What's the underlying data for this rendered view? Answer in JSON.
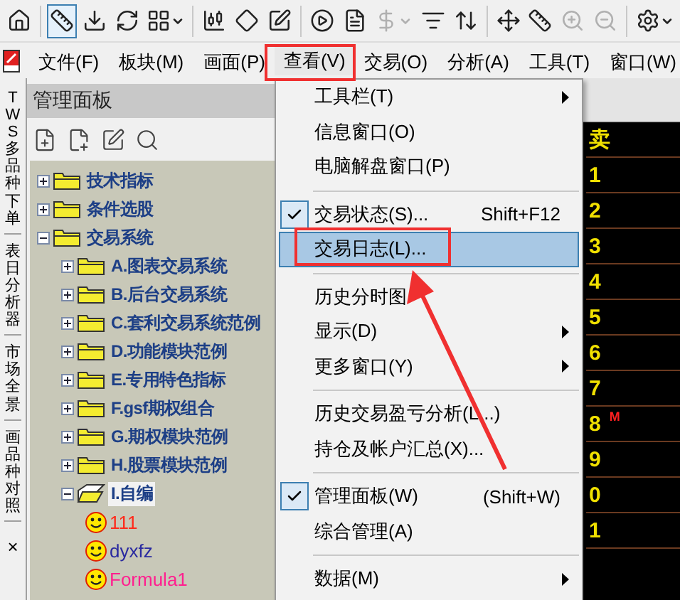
{
  "toolbar": [
    {
      "kind": "button",
      "selected": false,
      "disabled": false
    },
    {
      "kind": "separator"
    },
    {
      "kind": "button",
      "selected": true,
      "disabled": false
    },
    {
      "kind": "button",
      "selected": false,
      "disabled": false
    },
    {
      "kind": "button",
      "selected": false,
      "disabled": false
    },
    {
      "kind": "dropdown",
      "selected": false,
      "disabled": false
    },
    {
      "kind": "separator"
    },
    {
      "kind": "button",
      "selected": false,
      "disabled": false
    },
    {
      "kind": "button",
      "selected": false,
      "disabled": false
    },
    {
      "kind": "button",
      "selected": false,
      "disabled": false
    },
    {
      "kind": "separator"
    },
    {
      "kind": "button",
      "selected": false,
      "disabled": false
    },
    {
      "kind": "button",
      "selected": false,
      "disabled": false
    },
    {
      "kind": "dropdown",
      "selected": false,
      "disabled": true
    },
    {
      "kind": "button",
      "selected": false,
      "disabled": false
    },
    {
      "kind": "button",
      "selected": false,
      "disabled": false
    },
    {
      "kind": "separator"
    },
    {
      "kind": "button",
      "selected": false,
      "disabled": false
    },
    {
      "kind": "button",
      "selected": false,
      "disabled": false
    },
    {
      "kind": "button",
      "selected": false,
      "disabled": true
    },
    {
      "kind": "button",
      "selected": false,
      "disabled": true
    },
    {
      "kind": "separator"
    },
    {
      "kind": "dropdown",
      "selected": false,
      "disabled": false
    }
  ],
  "menubar": [
    {
      "label": "文件(F)",
      "selected": false
    },
    {
      "label": "板块(M)",
      "selected": false
    },
    {
      "label": "画面(P)",
      "selected": false
    },
    {
      "label": "查看(V)",
      "selected": true
    },
    {
      "label": "交易(O)",
      "selected": false
    },
    {
      "label": "分析(A)",
      "selected": false
    },
    {
      "label": "工具(T)",
      "selected": false
    },
    {
      "label": "窗口(W)",
      "selected": false
    }
  ],
  "side_tabs": [
    {
      "label": "TWS多品种下单"
    },
    {
      "label": "表日分析器"
    },
    {
      "label": "市场全景"
    },
    {
      "label": "画品种对照"
    }
  ],
  "side_close": "×",
  "panel": {
    "title": "管理面板",
    "tree": [
      {
        "kind": "folder",
        "label": "技术指标",
        "expanded": false,
        "selected": false
      },
      {
        "kind": "folder",
        "label": "条件选股",
        "expanded": false,
        "selected": false
      },
      {
        "kind": "folder",
        "label": "交易系统",
        "expanded": true,
        "selected": false,
        "children": [
          {
            "kind": "folder",
            "label": "A.图表交易系统",
            "expanded": false,
            "selected": false
          },
          {
            "kind": "folder",
            "label": "B.后台交易系统",
            "expanded": false,
            "selected": false
          },
          {
            "kind": "folder",
            "label": "C.套利交易系统范例",
            "expanded": false,
            "selected": false
          },
          {
            "kind": "folder",
            "label": "D.功能模块范例",
            "expanded": false,
            "selected": false
          },
          {
            "kind": "folder",
            "label": "E.专用特色指标",
            "expanded": false,
            "selected": false
          },
          {
            "kind": "folder",
            "label": "F.gsf期权组合",
            "expanded": false,
            "selected": false
          },
          {
            "kind": "folder",
            "label": "G.期权模块范例",
            "expanded": false,
            "selected": false
          },
          {
            "kind": "folder",
            "label": "H.股票模块范例",
            "expanded": false,
            "selected": false
          },
          {
            "kind": "folder",
            "label": "I.自编",
            "expanded": true,
            "selected": true,
            "children": [
              {
                "kind": "formula",
                "label": "111",
                "color": "#ff2a1a",
                "selected": false
              },
              {
                "kind": "formula",
                "label": "dyxfz",
                "color": "#2a2aa0",
                "selected": false
              },
              {
                "kind": "formula",
                "label": "Formula1",
                "color": "#ff1f8f",
                "selected": false
              }
            ]
          }
        ]
      }
    ]
  },
  "quote_column": {
    "header": "卖",
    "rows": [
      {
        "label": "1"
      },
      {
        "label": "2"
      },
      {
        "label": "3"
      },
      {
        "label": "4"
      },
      {
        "label": "5"
      },
      {
        "label": "6"
      },
      {
        "label": "7"
      },
      {
        "label": "8",
        "marker": "M"
      },
      {
        "label": "9"
      },
      {
        "label": "0"
      },
      {
        "label": "1"
      }
    ]
  },
  "menu": {
    "items": [
      {
        "kind": "item",
        "label": "工具栏(T)",
        "submenu": true,
        "checked": false,
        "selected": false
      },
      {
        "kind": "item",
        "label": "信息窗口(O)",
        "submenu": false,
        "checked": false,
        "selected": false
      },
      {
        "kind": "item",
        "label": "电脑解盘窗口(P)",
        "submenu": false,
        "checked": false,
        "selected": false
      },
      {
        "kind": "separator"
      },
      {
        "kind": "item",
        "label": "交易状态(S)...",
        "shortcut": "Shift+F12",
        "submenu": false,
        "checked": true,
        "selected": false
      },
      {
        "kind": "item",
        "label": "交易日志(L)...",
        "submenu": false,
        "checked": false,
        "selected": true
      },
      {
        "kind": "separator"
      },
      {
        "kind": "item",
        "label": "历史分时图",
        "submenu": false,
        "checked": false,
        "selected": false
      },
      {
        "kind": "item",
        "label": "显示(D)",
        "submenu": true,
        "checked": false,
        "selected": false
      },
      {
        "kind": "item",
        "label": "更多窗口(Y)",
        "submenu": true,
        "checked": false,
        "selected": false
      },
      {
        "kind": "separator"
      },
      {
        "kind": "item",
        "label": "历史交易盈亏分析(L...)",
        "submenu": false,
        "checked": false,
        "selected": false
      },
      {
        "kind": "item",
        "label": "持仓及帐户汇总(X)...",
        "submenu": false,
        "checked": false,
        "selected": false
      },
      {
        "kind": "separator"
      },
      {
        "kind": "item",
        "label": "管理面板(W)",
        "shortcut": "(Shift+W)",
        "submenu": false,
        "checked": true,
        "selected": false
      },
      {
        "kind": "item",
        "label": "综合管理(A)",
        "submenu": false,
        "checked": false,
        "selected": false
      },
      {
        "kind": "separator"
      },
      {
        "kind": "item",
        "label": "数据(M)",
        "submenu": true,
        "checked": false,
        "selected": false
      }
    ]
  }
}
